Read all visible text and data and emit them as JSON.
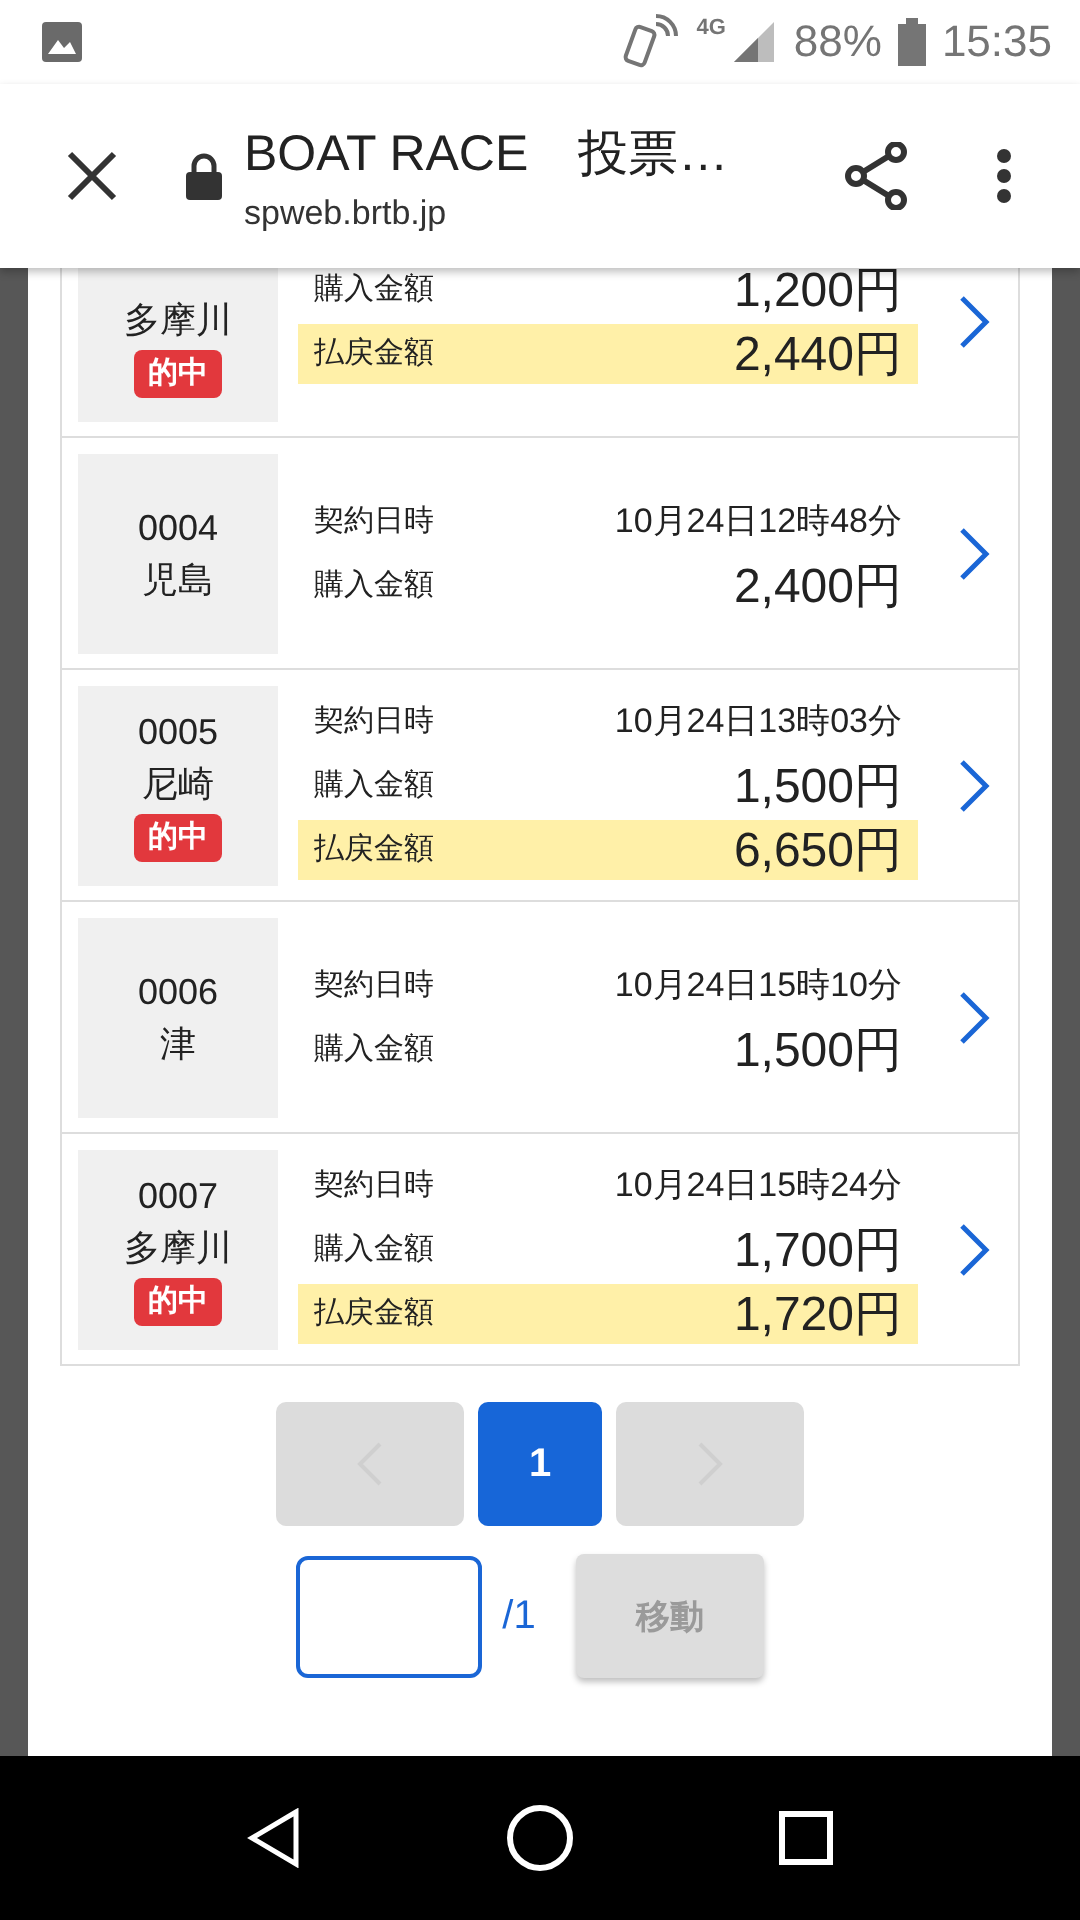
{
  "status_bar": {
    "network": "4G",
    "battery": "88%",
    "time": "15:35"
  },
  "browser": {
    "title": "BOAT RACE　投票…",
    "url": "spweb.brtb.jp"
  },
  "bets": [
    {
      "venue": "多摩川",
      "badge": "的中",
      "lines": [
        {
          "kind": "purchase",
          "label": "購入金額",
          "value": "1,200円"
        },
        {
          "kind": "payout",
          "label": "払戻金額",
          "value": "2,440円"
        }
      ]
    },
    {
      "number": "0004",
      "venue": "児島",
      "lines": [
        {
          "kind": "date",
          "label": "契約日時",
          "value": "10月24日12時48分"
        },
        {
          "kind": "purchase",
          "label": "購入金額",
          "value": "2,400円"
        }
      ]
    },
    {
      "number": "0005",
      "venue": "尼崎",
      "badge": "的中",
      "lines": [
        {
          "kind": "date",
          "label": "契約日時",
          "value": "10月24日13時03分"
        },
        {
          "kind": "purchase",
          "label": "購入金額",
          "value": "1,500円"
        },
        {
          "kind": "payout",
          "label": "払戻金額",
          "value": "6,650円"
        }
      ]
    },
    {
      "number": "0006",
      "venue": "津",
      "lines": [
        {
          "kind": "date",
          "label": "契約日時",
          "value": "10月24日15時10分"
        },
        {
          "kind": "purchase",
          "label": "購入金額",
          "value": "1,500円"
        }
      ]
    },
    {
      "number": "0007",
      "venue": "多摩川",
      "badge": "的中",
      "lines": [
        {
          "kind": "date",
          "label": "契約日時",
          "value": "10月24日15時24分"
        },
        {
          "kind": "purchase",
          "label": "購入金額",
          "value": "1,700円"
        },
        {
          "kind": "payout",
          "label": "払戻金額",
          "value": "1,720円"
        }
      ]
    }
  ],
  "pagination": {
    "prev_disabled": true,
    "pages": [
      {
        "label": "1",
        "selected": true
      }
    ],
    "next_disabled": true
  },
  "jump": {
    "total": "/1",
    "button": "移動",
    "disabled": true
  }
}
